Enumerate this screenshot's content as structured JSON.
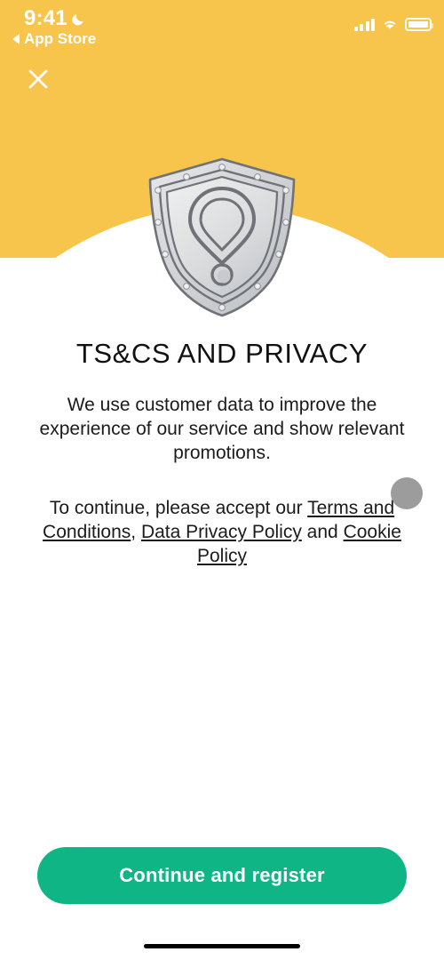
{
  "status_bar": {
    "time": "9:41",
    "dnd_icon": "moon-icon",
    "back_label": "App Store",
    "back_icon": "triangle-left-icon",
    "signal_icon": "cellular-signal-icon",
    "wifi_icon": "wifi-icon",
    "battery_icon": "battery-full-icon"
  },
  "header": {
    "background_color": "#f7c44c",
    "close_icon": "close-icon"
  },
  "illustration": {
    "name": "shield-warning-icon",
    "description": "grey metal shield with rivets and exclamation mark"
  },
  "main": {
    "title": "TS&CS AND PRIVACY",
    "paragraph_1": "We use customer data to improve the experience of our service and show relevant promotions.",
    "paragraph_2": {
      "lead": "To continue, please accept our ",
      "link_1": "Terms and Conditions",
      "sep_1": ", ",
      "link_2": "Data Privacy Policy",
      "sep_2": " and ",
      "link_3": "Cookie Policy"
    }
  },
  "cta": {
    "label": "Continue and register",
    "color": "#10b585"
  },
  "pointer": {
    "name": "touch-indicator",
    "color": "#9c9c9c"
  },
  "home_indicator": {
    "color": "#000000"
  }
}
